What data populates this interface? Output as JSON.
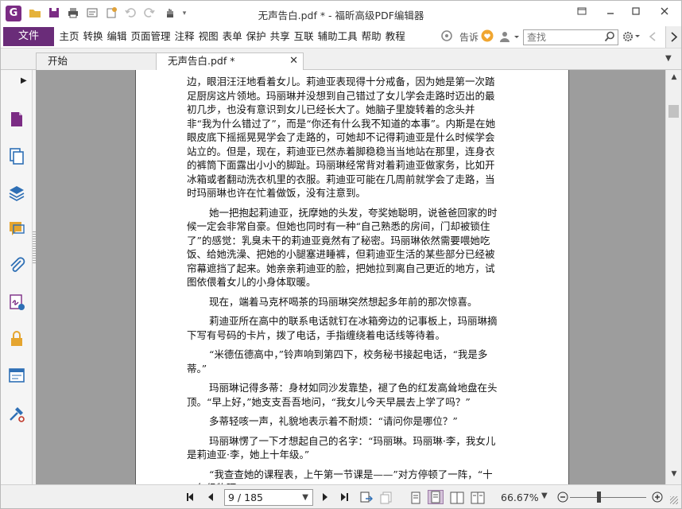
{
  "window": {
    "title": "无声告白.pdf * - 福昕高级PDF编辑器",
    "logo_letter": "G",
    "controls": [
      "restore-icon",
      "minimize-icon",
      "maximize-icon",
      "close-icon"
    ]
  },
  "quick_access": [
    "open-folder-icon",
    "save-icon",
    "print-icon",
    "form-icon",
    "new-icon",
    "undo-icon",
    "redo-icon",
    "hand-tool-icon"
  ],
  "menu": {
    "file_label": "文件",
    "items": [
      "主页",
      "转换",
      "编辑",
      "页面管理",
      "注释",
      "视图",
      "表单",
      "保护",
      "共享",
      "互联",
      "辅助工具",
      "帮助",
      "教程"
    ],
    "tell_label": "告诉",
    "search_placeholder": "查找"
  },
  "tabs": [
    {
      "label": "开始",
      "active": false
    },
    {
      "label": "无声告白.pdf *",
      "active": true
    }
  ],
  "left_nav": [
    "page-thumbnail-icon",
    "copy-pages-icon",
    "layers-icon",
    "comments-icon",
    "attachment-icon",
    "signature-icon",
    "security-lock-icon",
    "form-fields-icon",
    "tools-icon"
  ],
  "document": {
    "paragraphs": [
      {
        "indent": false,
        "lines": [
          "边，眼泪汪汪地看着女儿。莉迪亚表现得十分戒备，因为她是第一次踏",
          "足厨房这片领地。玛丽琳并没想到自己错过了女儿学会走路时迈出的最",
          "初几步，也没有意识到女儿已经长大了。她脑子里旋转着的念头并",
          "非“我为什么错过了”，而是“你还有什么我不知道的本事”。内斯是在她",
          "眼皮底下摇摇晃晃学会了走路的，可她却不记得莉迪亚是什么时候学会",
          "站立的。但是，现在，莉迪亚已然赤着脚稳稳当当地站在那里，连身衣",
          "的裤筒下面露出小小的脚趾。玛丽琳经常背对着莉迪亚做家务，比如开",
          "冰箱或者翻动洗衣机里的衣服。莉迪亚可能在几周前就学会了走路，当",
          "时玛丽琳也许在忙着做饭，没有注意到。"
        ]
      },
      {
        "indent": true,
        "lines": [
          "她一把抱起莉迪亚，抚摩她的头发，夸奖她聪明，说爸爸回家的时",
          "候一定会非常自豪。但她也同时有一种“自己熟悉的房间，门却被锁住",
          "了”的感觉：乳臭未干的莉迪亚竟然有了秘密。玛丽琳依然需要喂她吃",
          "饭、给她洗澡、把她的小腿塞进睡裤，但莉迪亚生活的某些部分已经被",
          "帘幕遮挡了起来。她亲亲莉迪亚的脸，把她拉到离自己更近的地方，试",
          "图依偎着女儿的小身体取暖。"
        ]
      },
      {
        "indent": true,
        "lines": [
          "现在，端着马克杯喝茶的玛丽琳突然想起多年前的那次惊喜。"
        ]
      },
      {
        "indent": true,
        "lines": [
          "莉迪亚所在高中的联系电话就钉在冰箱旁边的记事板上，玛丽琳摘",
          "下写有号码的卡片，拨了电话，手指缠绕着电话线等待着。"
        ]
      },
      {
        "indent": true,
        "lines": [
          "“米德伍德高中，”铃声响到第四下，校务秘书接起电话，“我是多",
          "蒂。”"
        ]
      },
      {
        "indent": true,
        "lines": [
          "玛丽琳记得多蒂：身材如同沙发靠垫，褪了色的红发高耸地盘在头",
          "顶。“早上好，”她支支吾吾地问，“我女儿今天早晨去上学了吗？”"
        ]
      },
      {
        "indent": true,
        "lines": [
          "多蒂轻咳一声，礼貌地表示着不耐烦：“请问你是哪位？”"
        ]
      },
      {
        "indent": true,
        "lines": [
          "玛丽琳愣了一下才想起自己的名字：“玛丽琳。玛丽琳·李，我女儿",
          "是莉迪亚·李，她上十年级。”"
        ]
      },
      {
        "indent": true,
        "lines": [
          "“我查查她的课程表，上午第一节课是——”对方停顿了一阵，“十",
          "一年级物理。”"
        ]
      }
    ]
  },
  "status": {
    "page_display": "9 / 185",
    "zoom": "66.67%",
    "zoom_level_fraction": 0.37
  },
  "colors": {
    "brand": "#6a2c79",
    "doc_background": "#9d9d9d"
  }
}
